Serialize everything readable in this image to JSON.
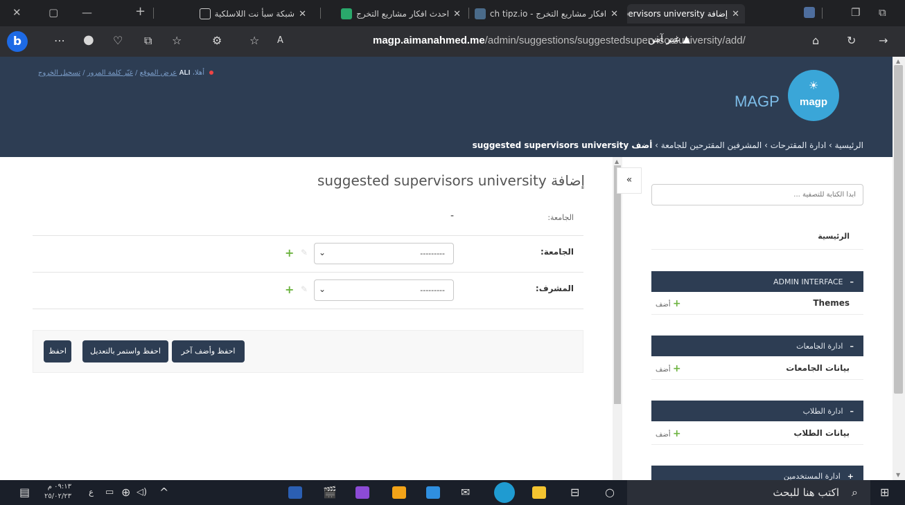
{
  "browser": {
    "tabs": [
      {
        "title": "شبكة سبأ نت اللاسلكية"
      },
      {
        "title": "احدث افكار مشاريع التخرج"
      },
      {
        "title": "افكار مشاريع التخرج - ch tipz.io"
      },
      {
        "title": "إضافة MAGP | suggested supervisors university"
      }
    ],
    "address": {
      "domain": "magp.aimanahmed.me",
      "path": "/admin/suggestions/suggestedsupervisorsuniversity/add/"
    },
    "security_label": "غير آمن",
    "bing": "b"
  },
  "header": {
    "welcome": "أهلا،",
    "username": "ALI",
    "links": {
      "view_site": "عرض الموقع",
      "change_password": "غيّر كلمة المرور",
      "logout": "تسجيل الخروج"
    },
    "brand": "MAGP",
    "logo_text": "magp",
    "breadcrumbs": [
      "الرئيسية",
      "ادارة المقترحات",
      "المشرفين المقترحين للجامعة",
      "أضف suggested supervisors university"
    ]
  },
  "main": {
    "title": "إضافة suggested supervisors university",
    "readonly_field": {
      "label": "الجامعة:",
      "value": "-"
    },
    "fields": [
      {
        "label": "الجامعة:",
        "value": "---------"
      },
      {
        "label": "المشرف:",
        "value": "---------"
      }
    ],
    "buttons": {
      "save": "احفظ",
      "save_continue": "احفظ واستمر بالتعديل",
      "save_add": "احفظ وأضف آخر"
    }
  },
  "sidebar": {
    "toggle": "«",
    "filter_placeholder": "ابدأ الكتابة للتصفية ...",
    "home": "الرئيسية",
    "add_label": "أضف",
    "modules": [
      {
        "title": "ADMIN INTERFACE",
        "sign": "–",
        "model": "Themes"
      },
      {
        "title": "ادارة الجامعات",
        "sign": "–",
        "model": "بيانات الجامعات"
      },
      {
        "title": "ادارة الطلاب",
        "sign": "–",
        "model": "بيانات الطلاب"
      },
      {
        "title": "ادارة المستخدمين",
        "sign": "+"
      }
    ]
  },
  "taskbar": {
    "search_placeholder": "اكتب هنا للبحث",
    "time": "٠٩:١٣ م",
    "date": "٢٥/٠٢/٢٣",
    "lang": "ع"
  },
  "colors": {
    "header_bg": "#2d3d53",
    "accent_link": "#7a9cc7",
    "add_green": "#6cb33f",
    "logo_bg": "#3aa6d8"
  }
}
